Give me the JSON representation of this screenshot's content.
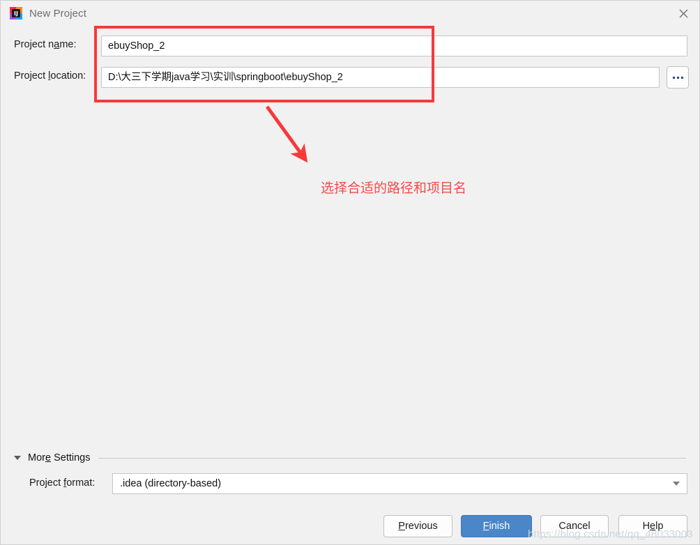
{
  "window": {
    "title": "New Project",
    "app_icon": "intellij-idea-icon",
    "close_icon": "close-icon"
  },
  "form": {
    "project_name": {
      "label_prefix": "Project n",
      "label_mnemonic": "a",
      "label_suffix": "me:",
      "value": "ebuyShop_2",
      "placeholder": ""
    },
    "project_location": {
      "label_prefix": "Project ",
      "label_mnemonic": "l",
      "label_suffix": "ocation:",
      "value": "D:\\大三下学期java学习\\实训\\springboot\\ebuyShop_2",
      "placeholder": ""
    },
    "browse_button_label": "..."
  },
  "annotation": {
    "caption": "选择合适的路径和项目名",
    "color": "#f74a4a",
    "box_color": "#f63a3a"
  },
  "more_settings": {
    "label_prefix": "Mor",
    "label_mnemonic": "e",
    "label_suffix": " Settings",
    "expanded": true,
    "project_format": {
      "label_prefix": "Project ",
      "label_mnemonic": "f",
      "label_suffix": "ormat:",
      "selected": ".idea (directory-based)",
      "options": [
        ".idea (directory-based)"
      ]
    }
  },
  "buttons": {
    "previous": {
      "prefix": "",
      "mnemonic": "P",
      "suffix": "revious"
    },
    "finish": {
      "prefix": "",
      "mnemonic": "F",
      "suffix": "inish"
    },
    "cancel": {
      "prefix": "Cancel",
      "mnemonic": "",
      "suffix": ""
    },
    "help": {
      "prefix": "H",
      "mnemonic": "e",
      "suffix": "lp"
    }
  },
  "watermark": {
    "text": "https://blog.csdn.net/qq_48033003"
  },
  "colors": {
    "background": "#f1f1f1",
    "accent_button": "#4a86c8",
    "annotation_red": "#f63a3a"
  }
}
